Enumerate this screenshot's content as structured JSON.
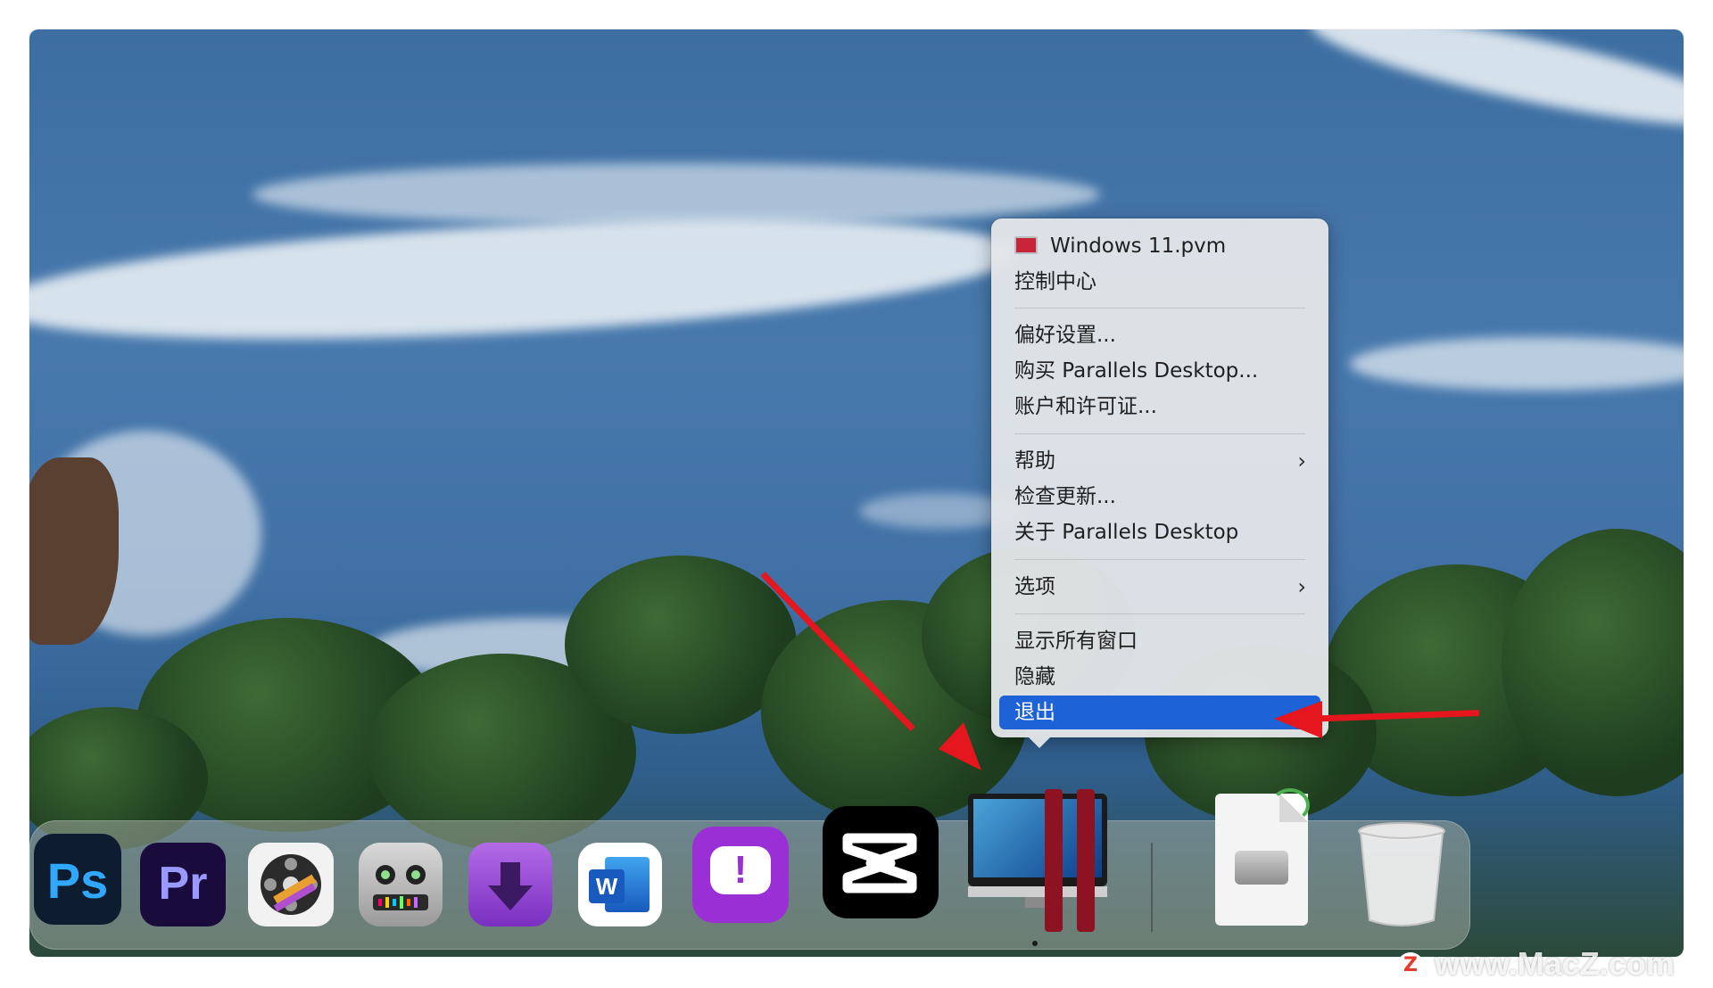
{
  "context_menu": {
    "items": [
      {
        "label": "Windows 11.pvm"
      },
      {
        "label": "控制中心"
      },
      {
        "label": "偏好设置..."
      },
      {
        "label": "购买 Parallels Desktop..."
      },
      {
        "label": "账户和许可证..."
      },
      {
        "label": "帮助",
        "submenu": true
      },
      {
        "label": "检查更新..."
      },
      {
        "label": "关于 Parallels Desktop"
      },
      {
        "label": "选项",
        "submenu": true
      },
      {
        "label": "显示所有窗口"
      },
      {
        "label": "隐藏"
      },
      {
        "label": "退出",
        "highlighted": true
      }
    ],
    "highlight_color": "#1d62d6"
  },
  "dock": {
    "apps": [
      {
        "name": "Adobe Photoshop",
        "icon": "photoshop-icon",
        "text": "Ps",
        "color": "#0d1c2e"
      },
      {
        "name": "Adobe Premiere Pro",
        "icon": "premiere-icon",
        "text": "Pr",
        "color": "#1a0b3d"
      },
      {
        "name": "Final Cut Pro",
        "icon": "final-cut-icon"
      },
      {
        "name": "Voice Robot",
        "icon": "robot-icon"
      },
      {
        "name": "Downie",
        "icon": "download-arrow-icon"
      },
      {
        "name": "Microsoft Word",
        "icon": "word-icon",
        "text": "W"
      },
      {
        "name": "Alert App",
        "icon": "alert-icon",
        "text": "!"
      },
      {
        "name": "CapCut",
        "icon": "capcut-icon"
      },
      {
        "name": "Parallels Desktop",
        "icon": "parallels-icon"
      },
      {
        "name": "Disk Image",
        "icon": "disk-image-icon"
      },
      {
        "name": "Trash",
        "icon": "trash-icon"
      }
    ]
  },
  "annotation_color": "#e5161d",
  "watermark": {
    "badge": "Z",
    "text": "www.MacZ.com"
  }
}
